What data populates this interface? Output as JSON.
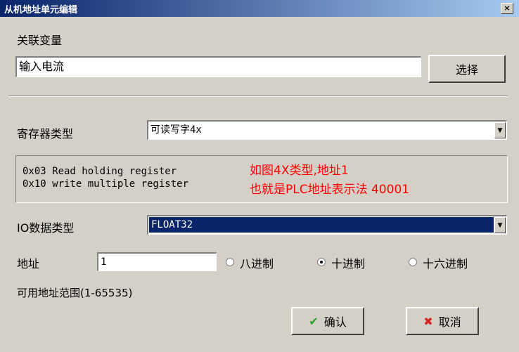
{
  "window": {
    "title": "从机地址单元编辑",
    "close_glyph": "×"
  },
  "linked_var": {
    "label": "关联变量",
    "value": "输入电流",
    "select_label": "选择"
  },
  "register": {
    "label": "寄存器类型",
    "value": "可读写字4x",
    "desc_lines": [
      "0x03 Read holding register",
      "0x10 write multiple register"
    ],
    "note_lines": [
      "如图4X类型,地址1",
      "也就是PLC地址表示法 40001"
    ]
  },
  "io": {
    "label": "IO数据类型",
    "value": "FLOAT32"
  },
  "address": {
    "label": "地址",
    "value": "1",
    "radios": [
      {
        "label": "八进制",
        "checked": false
      },
      {
        "label": "十进制",
        "checked": true
      },
      {
        "label": "十六进制",
        "checked": false
      }
    ],
    "range_text": "可用地址范围(1-65535)"
  },
  "buttons": {
    "ok": "确认",
    "cancel": "取消"
  },
  "colors": {
    "title_start": "#0a246a",
    "title_end": "#a6caf0",
    "note": "#ff0000",
    "selected": "#0a246a"
  },
  "icons": {
    "close": "close-icon",
    "dropdown": "chevron-down-icon",
    "ok": "check-icon",
    "cancel": "x-icon"
  }
}
